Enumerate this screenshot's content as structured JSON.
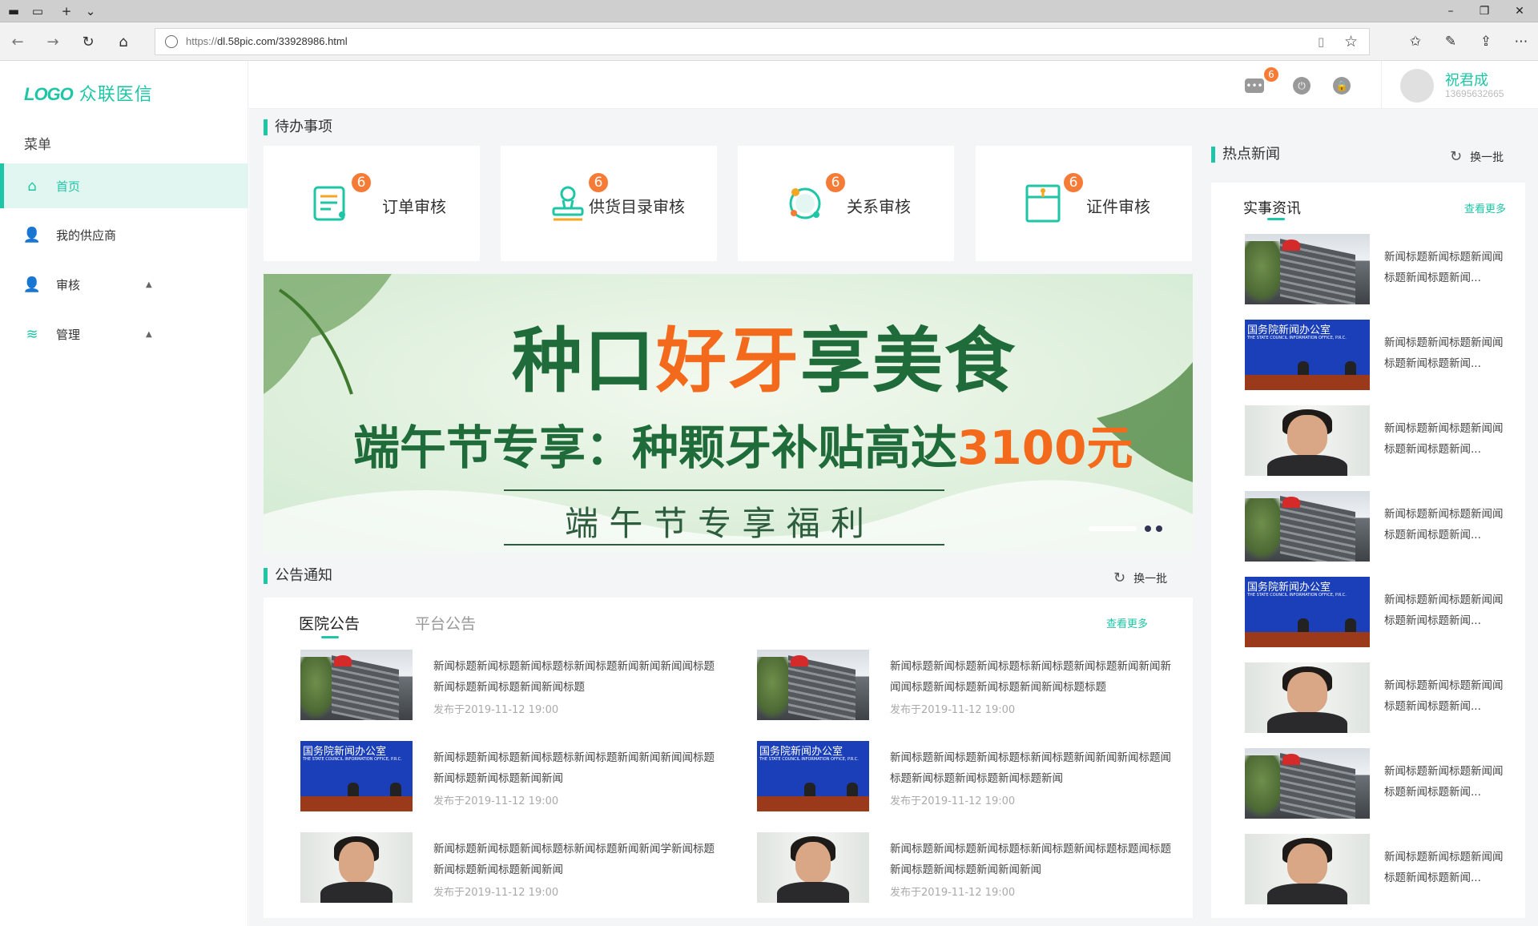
{
  "browser": {
    "url_prefix": "https://",
    "url_rest": "dl.58pic.com/33928986.html"
  },
  "app": {
    "logo_mark": "LOGO",
    "logo_name": "众联医信",
    "menu_title": "菜单"
  },
  "menu": [
    {
      "label": "首页",
      "icon": "home-icon"
    },
    {
      "label": "我的供应商",
      "icon": "supplier-icon"
    },
    {
      "label": "审核",
      "icon": "user-icon"
    },
    {
      "label": "管理",
      "icon": "layers-icon"
    }
  ],
  "topbar": {
    "msg_badge": "6",
    "user_name": "祝君成",
    "user_phone": "13695632665"
  },
  "todo": {
    "title": "待办事项",
    "cards": [
      {
        "label": "订单审核",
        "badge": "6"
      },
      {
        "label": "供货目录审核",
        "badge": "6"
      },
      {
        "label": "关系审核",
        "badge": "6"
      },
      {
        "label": "证件审核",
        "badge": "6"
      }
    ]
  },
  "banner": {
    "line1_a": "种口",
    "line1_b": "好牙",
    "line1_c": "享美食",
    "line2_a": "端午节专享：种颗牙补贴高达",
    "line2_b": "3100元",
    "line3": "端 午 节 专 享 福 利"
  },
  "notice": {
    "title": "公告通知",
    "refresh": "换一批",
    "tab_active": "医院公告",
    "tab_inactive": "平台公告",
    "more": "查看更多",
    "items": [
      {
        "text": "新闻标题新闻标题新闻标题标新闻标题新闻新闻新闻闻标题新闻标题新闻标题新闻新闻标题",
        "date": "发布于2019-11-12    19:00",
        "img": "huawei"
      },
      {
        "text": "新闻标题新闻标题新闻标题标新闻标题新闻标题新闻新闻新闻闻标题新闻标题新闻标题新闻新闻标题标题",
        "date": "发布于2019-11-12    19:00",
        "img": "huawei"
      },
      {
        "text": "新闻标题新闻标题新闻标题标新闻标题新闻新闻新闻闻标题新闻标题新闻标题新闻新闻",
        "date": "发布于2019-11-12    19:00",
        "img": "gov"
      },
      {
        "text": "新闻标题新闻标题新闻标题标新闻标题新闻新闻新闻标题闻标题新闻标题新闻标题新闻标题新闻",
        "date": "发布于2019-11-12    19:00",
        "img": "gov"
      },
      {
        "text": "新闻标题新闻标题新闻标题标新闻标题新闻新闻学新闻标题新闻标题新闻标题新闻新闻",
        "date": "发布于2019-11-12    19:00",
        "img": "person"
      },
      {
        "text": "新闻标题新闻标题新闻标题标新闻标题新闻标题标题闻标题新闻标题新闻标题新闻新闻新闻",
        "date": "发布于2019-11-12    19:00",
        "img": "person"
      }
    ]
  },
  "hot": {
    "title": "热点新闻",
    "refresh": "换一批",
    "tab": "实事资讯",
    "more": "查看更多",
    "items": [
      {
        "text": "新闻标题新闻标题新闻闻标题新闻标题新闻...",
        "img": "huawei"
      },
      {
        "text": "新闻标题新闻标题新闻闻标题新闻标题新闻...",
        "img": "gov"
      },
      {
        "text": "新闻标题新闻标题新闻闻标题新闻标题新闻...",
        "img": "person"
      },
      {
        "text": "新闻标题新闻标题新闻闻标题新闻标题新闻...",
        "img": "huawei"
      },
      {
        "text": "新闻标题新闻标题新闻闻标题新闻标题新闻...",
        "img": "gov"
      },
      {
        "text": "新闻标题新闻标题新闻闻标题新闻标题新闻...",
        "img": "person"
      },
      {
        "text": "新闻标题新闻标题新闻闻标题新闻标题新闻...",
        "img": "huawei"
      },
      {
        "text": "新闻标题新闻标题新闻闻标题新闻标题新闻...",
        "img": "person"
      }
    ]
  },
  "thumb_text": {
    "gov_title": "国务院新闻办公室",
    "gov_sub": "THE STATE COUNCIL INFORMATION OFFICE, P.R.C."
  },
  "colors": {
    "accent": "#1ec6a6",
    "badge": "#f57b36",
    "banner_orange": "#f46a1d",
    "banner_green": "#1f6b3a"
  }
}
